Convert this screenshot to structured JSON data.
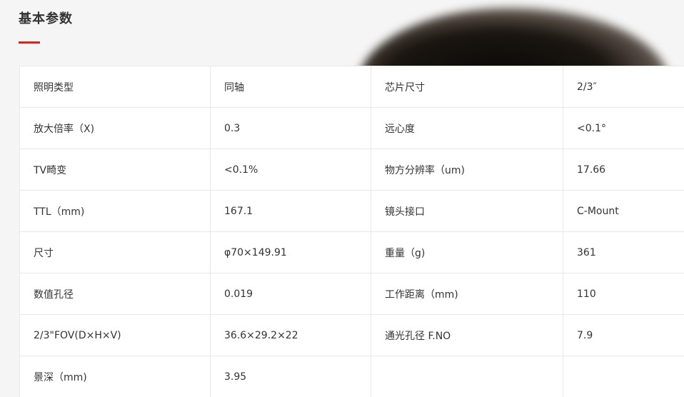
{
  "section": {
    "title": "基本参数"
  },
  "specs": [
    [
      "照明类型",
      "同轴",
      "芯片尺寸",
      "2/3″"
    ],
    [
      "放大倍率（X)",
      "0.3",
      "远心度",
      "<0.1°"
    ],
    [
      "TV畸变",
      "<0.1%",
      "物方分辨率（um)",
      "17.66"
    ],
    [
      "TTL（mm)",
      "167.1",
      "镜头接口",
      "C-Mount"
    ],
    [
      "尺寸",
      "φ70×149.91",
      "重量（g)",
      "361"
    ],
    [
      "数值孔径",
      "0.019",
      "工作距离（mm)",
      "110"
    ],
    [
      "2/3\"FOV(D×H×V)",
      "36.6×29.2×22",
      "通光孔径 F.NO",
      "7.9"
    ],
    [
      "景深（mm)",
      "3.95",
      "",
      ""
    ]
  ],
  "colors": {
    "accent": "#c0302a",
    "border": "#e8e8e8",
    "background": "#f5f5f5"
  }
}
